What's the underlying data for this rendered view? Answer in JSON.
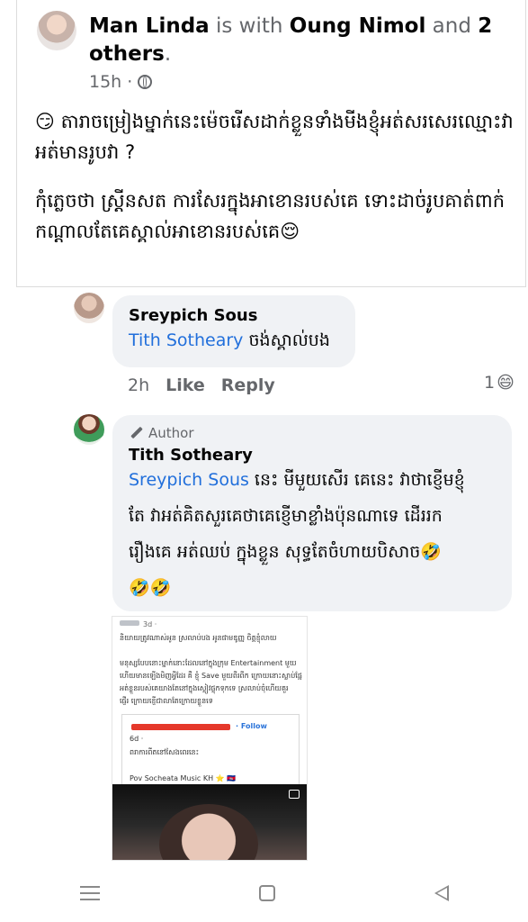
{
  "post": {
    "author": "Man Linda",
    "with_text": " is with ",
    "tagged": "Oung Nimol",
    "and_text": " and ",
    "others": "2 others",
    "period": ".",
    "time": "15h",
    "dot": "·",
    "paragraph1_emoji": "😏",
    "paragraph1": " តារាចម្រៀងម្នាក់នេះម៉េចរើសដាក់ខ្លួនទាំងមីងខ្ញុំអត់សរសេរឈ្មោះវា អត់មានរូបវា ?",
    "paragraph2": "កុំភ្លេចថា ស្ត្រីនសត ការសែរក្នុងអាខោនរបស់គេ ទោះដាច់រូបគាត់ពាក់កណ្ដាលតែគេស្គាល់អាខោនរបស់គេ",
    "paragraph2_emoji": "😌"
  },
  "comment1": {
    "name": "Sreypich Sous",
    "mention": "Tith Sotheary",
    "text": " ចង់ស្គាល់បង",
    "time": "2h",
    "like": "Like",
    "reply": "Reply",
    "reaction_count": "1",
    "reaction_emoji": "😄"
  },
  "comment2": {
    "badge": "Author",
    "name": "Tith Sotheary",
    "mention": "Sreypich Sous",
    "line1": "  នេះ មីមួយសើរ គេនេះ វាថាខ្ញើមខ្ញុំ",
    "line2": "តែ វាអត់គិតសួរគេថាគេខ្ញើមាខ្លាំងប៉ុនណាទេ ដើររក",
    "line3": "រឿងគេ អត់ឈប់ ក្នុងខ្លួន សុទ្ធតែចំហាយបិសាច",
    "line3_emoji": "🤣",
    "line4": "🤣🤣"
  },
  "shared_image": {
    "time": "3d · ",
    "line_top": "និយាយត្រូវណាស់អូន ស្រលាប់បង អូនផាមឌូញ្ញ ចិត្តខ្ញុំលាយ",
    "line_a": "មនុស្សបែបនោះម្នាក់នោះដែលនៅក្នុងក្រុម Entertainment មួយ",
    "line_b": "ហើយមានឡើងមិញអ្វីដែរ គឺ ខ្ញុំ Save មួយពីរពីក ក្រោយនោះស្លាប់ផ្អែ",
    "line_c": "អត់ខ្លួនរបស់គេយាងតែនៅក្នុងស្ទៀវផ្ទុកទុកទេ ស្រលាប់ចុំហើយគួរ",
    "line_d": "ផ្ញើរ ក្រោយខ្ញើជាលាតែក្រោយខ្លួនទេ",
    "follow": "· Follow",
    "inner_time": "6d · ",
    "inner_text": "ពរាការពីតនៅសែងពេរនេះ",
    "inner_page": "Pov Socheata Music KH ⭐ 🇰🇭"
  },
  "colors": {
    "mention": "#216fdb",
    "bubble": "#f0f2f5",
    "secondary_text": "#65676b"
  }
}
